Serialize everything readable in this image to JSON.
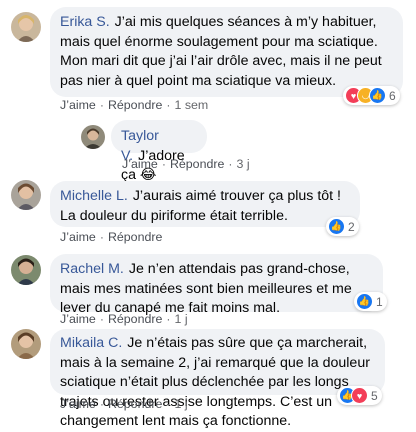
{
  "comments": [
    {
      "author": "Erika S.",
      "text": "J’ai mis quelques séances à m’y habituer, mais quel énorme soulagement pour ma sciatique. Mon mari dit que j’ai l’air drôle avec, mais il ne peut pas nier à quel point ma sciatique va mieux.",
      "like": "J’aime",
      "reply": "Répondre",
      "time": "1 sem",
      "reaction_count": "6",
      "reaction_icons": [
        "love-icon",
        "haha-icon",
        "like-icon"
      ]
    },
    {
      "author": "Taylor V.",
      "text": "J’adore ça 😂",
      "like": "J’aime",
      "reply": "Répondre",
      "time": "3 j"
    },
    {
      "author": "Michelle L.",
      "text": "J’aurais aimé trouver ça plus tôt ! La douleur du piriforme était terrible.",
      "like": "J’aime",
      "reply": "Répondre",
      "time": "",
      "reaction_count": "2",
      "reaction_icons": [
        "like-icon"
      ]
    },
    {
      "author": "Rachel M.",
      "text": "Je n’en attendais pas grand-chose, mais mes matinées sont bien meilleures et me lever du canapé me fait moins mal.",
      "like": "J’aime",
      "reply": "Répondre",
      "time": "1 j",
      "reaction_count": "1",
      "reaction_icons": [
        "like-icon"
      ]
    },
    {
      "author": "Mikaila C.",
      "text": "Je n’étais pas sûre que ça marcherait, mais à la semaine 2, j’ai remarqué que la douleur sciatique n’était plus déclenchée par les longs trajets ou rester assise longtemps. C’est un changement lent mais ça fonctionne.",
      "like": "J’aime",
      "reply": "Répondre",
      "time": "1 j",
      "reaction_count": "5",
      "reaction_icons": [
        "like-icon",
        "love-icon"
      ]
    }
  ],
  "colors": {
    "author": "#385898",
    "bubble": "#f0f2f5",
    "like": "#1877f2",
    "love": "#f33e58",
    "haha": "#f7b125"
  }
}
